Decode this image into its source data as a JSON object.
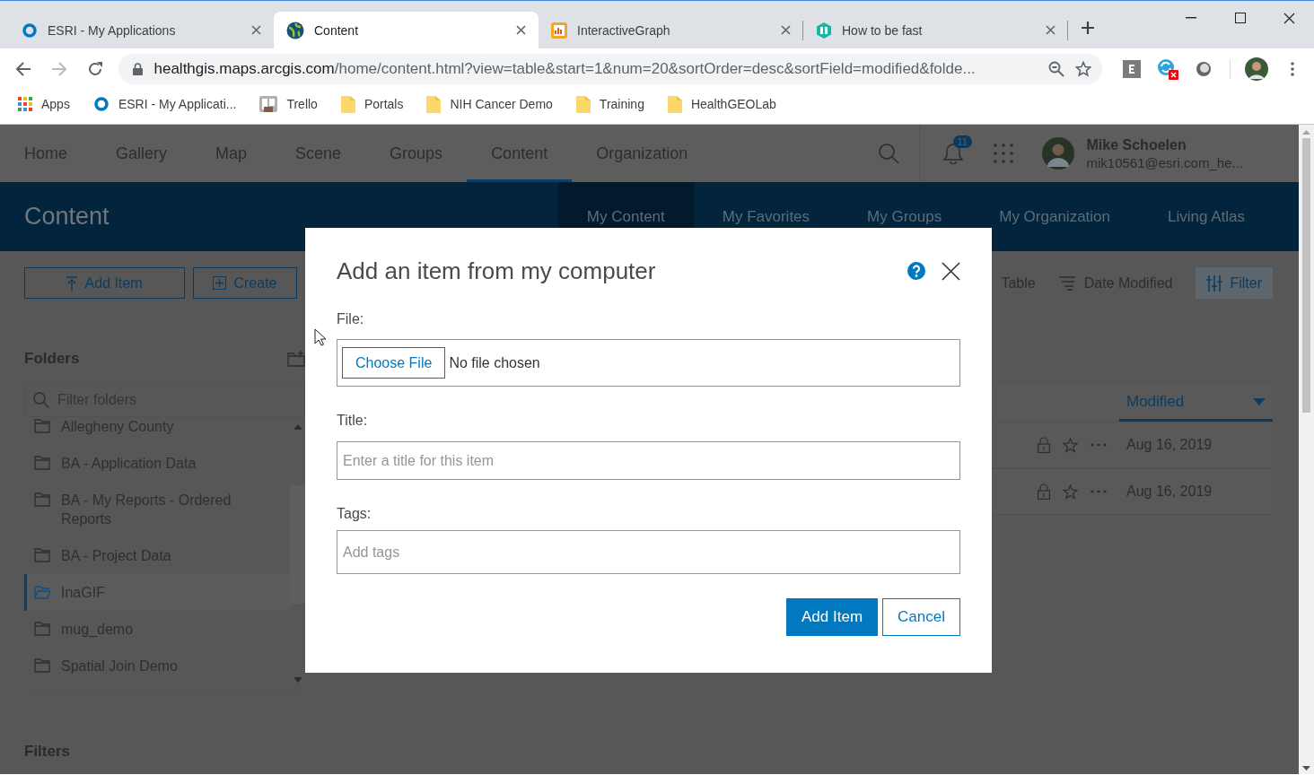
{
  "browser": {
    "tabs": [
      {
        "title": "ESRI - My Applications",
        "kind": "ring",
        "selected": false
      },
      {
        "title": "Content",
        "kind": "globe",
        "selected": true
      },
      {
        "title": "InteractiveGraph",
        "kind": "graph",
        "selected": false
      },
      {
        "title": "How to be fast",
        "kind": "book",
        "selected": false
      }
    ],
    "nav_buttons": [
      {
        "kind": "back",
        "disabled": false
      },
      {
        "kind": "forward",
        "disabled": true
      },
      {
        "kind": "reload",
        "disabled": false
      }
    ],
    "address": {
      "host": "healthgis.maps.arcgis.com",
      "path": "/home/content.html?view=table&start=1&num=20&sortOrder=desc&sortField=modified&folde..."
    },
    "bookmarks": [
      {
        "label": "Apps",
        "kind": "apps"
      },
      {
        "label": "ESRI - My Applicati...",
        "kind": "ring"
      },
      {
        "label": "Trello",
        "kind": "trello"
      },
      {
        "label": "Portals",
        "kind": "folder"
      },
      {
        "label": "NIH Cancer Demo",
        "kind": "folder"
      },
      {
        "label": "Training",
        "kind": "folder"
      },
      {
        "label": "HealthGEOLab",
        "kind": "folder"
      }
    ]
  },
  "nav": {
    "items": [
      {
        "label": "Home",
        "selected": false
      },
      {
        "label": "Gallery",
        "selected": false
      },
      {
        "label": "Map",
        "selected": false
      },
      {
        "label": "Scene",
        "selected": false
      },
      {
        "label": "Groups",
        "selected": false
      },
      {
        "label": "Content",
        "selected": true
      },
      {
        "label": "Organization",
        "selected": false
      }
    ],
    "notifications": "11",
    "user": {
      "name": "Mike Schoelen",
      "email": "mik10561@esri.com_he..."
    }
  },
  "banner": {
    "title": "Content",
    "tabs": [
      {
        "label": "My Content",
        "selected": true
      },
      {
        "label": "My Favorites",
        "selected": false
      },
      {
        "label": "My Groups",
        "selected": false
      },
      {
        "label": "My Organization",
        "selected": false
      },
      {
        "label": "Living Atlas",
        "selected": false
      }
    ]
  },
  "toolbar": {
    "actions": [
      {
        "label": "Add Item",
        "kind": "upload"
      },
      {
        "label": "Create",
        "kind": "create"
      }
    ],
    "view": "Table",
    "sort": "Date Modified",
    "filter": "Filter"
  },
  "folders": {
    "title": "Folders",
    "placeholder": "Filter folders",
    "items": [
      {
        "label": "Allegheny County",
        "selected": false
      },
      {
        "label": "BA - Application Data",
        "selected": false
      },
      {
        "label": "BA - My Reports - Ordered Reports",
        "selected": false
      },
      {
        "label": "BA - Project Data",
        "selected": false
      },
      {
        "label": "InaGIF",
        "selected": true
      },
      {
        "label": "mug_demo",
        "selected": false
      },
      {
        "label": "Spatial Join Demo",
        "selected": false
      }
    ]
  },
  "filters": {
    "title": "Filters"
  },
  "table": {
    "column": "Modified",
    "rows": [
      {
        "modified": "Aug 16, 2019"
      },
      {
        "modified": "Aug 16, 2019"
      }
    ]
  },
  "dialog": {
    "title": "Add an item from my computer",
    "file": {
      "label": "File:",
      "button": "Choose File",
      "status": "No file chosen"
    },
    "title_field": {
      "label": "Title:",
      "placeholder": "Enter a title for this item"
    },
    "tags_field": {
      "label": "Tags:",
      "placeholder": "Add tags"
    },
    "buttons": [
      {
        "label": "Add Item",
        "kind": "primary"
      },
      {
        "label": "Cancel",
        "kind": "secondary"
      }
    ]
  }
}
